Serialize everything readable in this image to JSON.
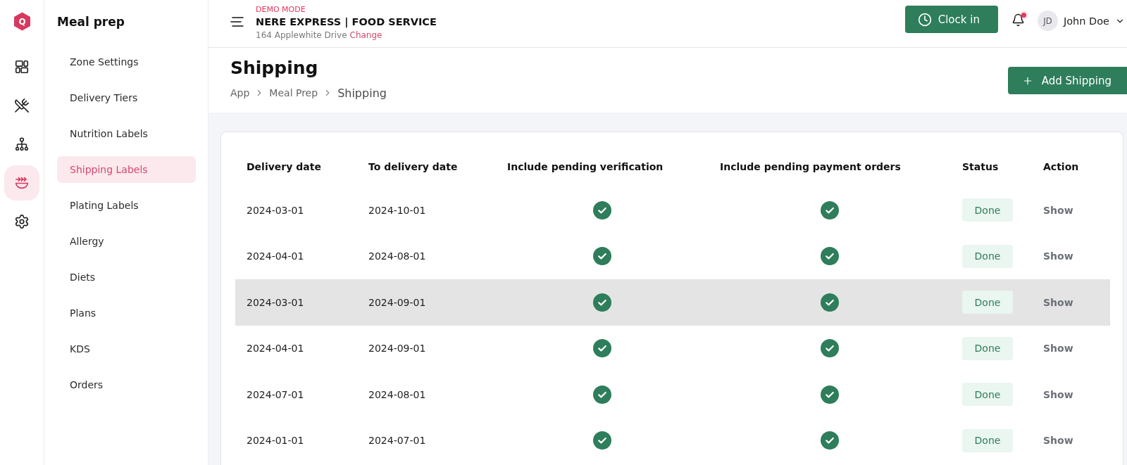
{
  "rail": {
    "logo_letter": "Q",
    "items": [
      {
        "selected": false
      },
      {
        "selected": false
      },
      {
        "selected": false
      },
      {
        "selected": true
      },
      {
        "selected": false
      }
    ]
  },
  "sidebar": {
    "title": "Meal prep",
    "items": [
      {
        "label": "Zone Settings",
        "selected": false
      },
      {
        "label": "Delivery Tiers",
        "selected": false
      },
      {
        "label": "Nutrition Labels",
        "selected": false
      },
      {
        "label": "Shipping Labels",
        "selected": true
      },
      {
        "label": "Plating Labels",
        "selected": false
      },
      {
        "label": "Allergy",
        "selected": false
      },
      {
        "label": "Diets",
        "selected": false
      },
      {
        "label": "Plans",
        "selected": false
      },
      {
        "label": "KDS",
        "selected": false
      },
      {
        "label": "Orders",
        "selected": false
      }
    ]
  },
  "header": {
    "demo_label": "DEMO MODE",
    "business_name": "NERE EXPRESS | FOOD SERVICE",
    "address": "164 Applewhite Drive",
    "change_link": "Change",
    "clock_in_button": "Clock in",
    "notifications": {
      "unread": true
    },
    "user": {
      "initials": "JD",
      "name": "John Doe"
    }
  },
  "page": {
    "title": "Shipping",
    "breadcrumb": [
      {
        "label": "App",
        "current": false
      },
      {
        "label": "Meal Prep",
        "current": false
      },
      {
        "label": "Shipping",
        "current": true
      }
    ],
    "add_button": "Add Shipping"
  },
  "table": {
    "columns": [
      "Delivery date",
      "To delivery date",
      "Include pending verification",
      "Include pending payment orders",
      "Status",
      "Action"
    ],
    "rows": [
      {
        "delivery_date": "2024-03-01",
        "to_delivery_date": "2024-10-01",
        "pending_verification": true,
        "pending_payment": true,
        "status": "Done",
        "action": "Show",
        "selected": false
      },
      {
        "delivery_date": "2024-04-01",
        "to_delivery_date": "2024-08-01",
        "pending_verification": true,
        "pending_payment": true,
        "status": "Done",
        "action": "Show",
        "selected": false
      },
      {
        "delivery_date": "2024-03-01",
        "to_delivery_date": "2024-09-01",
        "pending_verification": true,
        "pending_payment": true,
        "status": "Done",
        "action": "Show",
        "selected": true
      },
      {
        "delivery_date": "2024-04-01",
        "to_delivery_date": "2024-09-01",
        "pending_verification": true,
        "pending_payment": true,
        "status": "Done",
        "action": "Show",
        "selected": false
      },
      {
        "delivery_date": "2024-07-01",
        "to_delivery_date": "2024-08-01",
        "pending_verification": true,
        "pending_payment": true,
        "status": "Done",
        "action": "Show",
        "selected": false
      },
      {
        "delivery_date": "2024-01-01",
        "to_delivery_date": "2024-07-01",
        "pending_verification": true,
        "pending_payment": true,
        "status": "Done",
        "action": "Show",
        "selected": false
      }
    ]
  }
}
